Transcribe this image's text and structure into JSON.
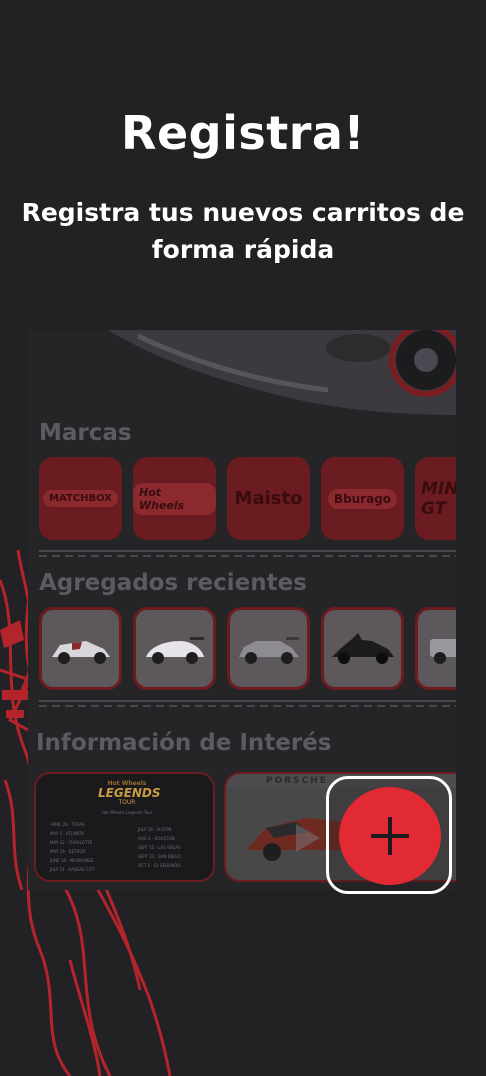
{
  "header": {
    "title": "Registra!",
    "subtitle": "Registra tus nuevos carritos de forma rápida"
  },
  "preview": {
    "brands_title": "Marcas",
    "brands": [
      {
        "name": "MATCHBOX"
      },
      {
        "name": "Hot Wheels"
      },
      {
        "name": "Maisto"
      },
      {
        "name": "Bburago"
      },
      {
        "name": "MINI GT"
      }
    ],
    "recent_title": "Agregados recientes",
    "recent": [
      "white-racer",
      "white-porsche",
      "gray-sedan",
      "black-batmobile",
      "gray-suv"
    ],
    "info_title": "Información de Interés",
    "info_cards": [
      {
        "badge": "LEGENDS",
        "badge_top": "Hot Wheels",
        "badge_sub": "TOUR",
        "heading": "Hot Wheels Legends Tour",
        "dates_left": [
          "APRIL 28 · TEXAS",
          "MAY 5 · ATLANTA",
          "MAY 12 · CHARLOTTE",
          "MAY 19 · DETROIT",
          "JUNE 16 · MILWAUKEE",
          "JULY 14 · KANSAS CITY"
        ],
        "dates_right": [
          "JULY 28 · AUSTIN",
          "AUG 4 · HOUSTON",
          "SEPT 15 · LAS VEGAS",
          "SEPT 21 · SAN DIEGO",
          "OCT 5 · EL SEGUNDO"
        ]
      },
      {
        "brand": "PORSCHE"
      }
    ]
  },
  "fab": {
    "icon": "plus-icon",
    "color": "#e12a34"
  },
  "colors": {
    "background": "#222124",
    "accent": "#e12a34",
    "tile": "#6b1c20"
  }
}
